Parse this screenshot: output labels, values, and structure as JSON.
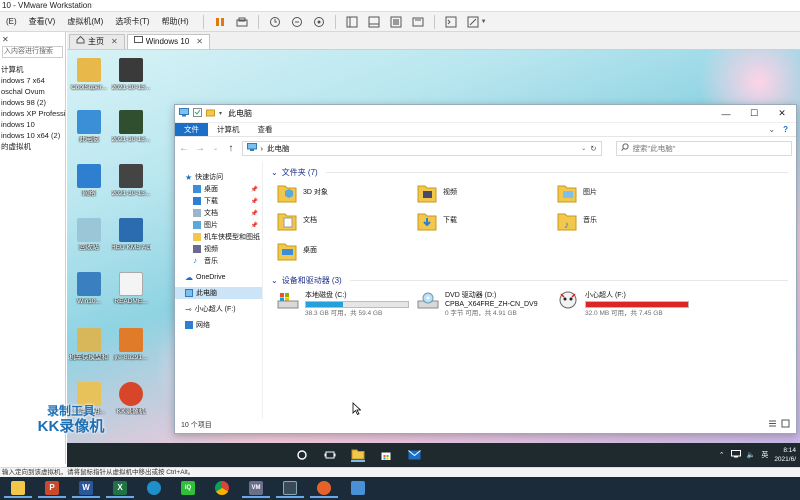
{
  "vmware": {
    "title": "10 - VMware Workstation",
    "menu": [
      "(E)",
      "查看(V)",
      "虚拟机(M)",
      "选项卡(T)",
      "帮助(H)"
    ],
    "library": {
      "search_placeholder": "入内容进行搜索",
      "items": [
        "计算机",
        "indows 7 x64",
        "oschal Ovum",
        "indows 98 (2)",
        "indows XP Professic",
        "indows 10",
        "indows 10 x64 (2)",
        "的虚拟机"
      ]
    },
    "tabs": [
      {
        "label": "主页",
        "icon": "home-icon"
      },
      {
        "label": "Windows 10",
        "icon": "vm-icon"
      }
    ],
    "status_text": "输入定向到该虚拟机，请将鼠标指针从虚拟机中移出或按 Ctrl+Alt。",
    "status_prefix": "到该"
  },
  "desktop": {
    "icons": [
      {
        "label": "CoolSuper...",
        "color": "#e8b84a"
      },
      {
        "label": "2021-10-13...",
        "color": "#3a3a3a"
      },
      {
        "label": "此电脑",
        "color": "#3b8fd6"
      },
      {
        "label": "2021-10-13...",
        "color": "#2f4f2f"
      },
      {
        "label": "网络",
        "color": "#2f7fd0"
      },
      {
        "label": "2021-10-13...",
        "color": "#444"
      },
      {
        "label": "回收站",
        "color": "#9ac6d8"
      },
      {
        "label": "HEU KMS Activato...",
        "color": "#2b6cb0"
      },
      {
        "label": "Win10...",
        "color": "#3a7fc0"
      },
      {
        "label": "README...",
        "color": "#f4f4f4"
      },
      {
        "label": "机车侠模型和...",
        "color": "#d8b65a"
      },
      {
        "label": "jre-8u291...",
        "color": "#e07b2a"
      },
      {
        "label": "使用说明...",
        "color": "#e7c15a"
      },
      {
        "label": "KK录像机",
        "color": "#d8462a"
      }
    ],
    "watermark": {
      "line1": "录制工具",
      "line2": "KK录像机"
    }
  },
  "explorer": {
    "title": "此电脑",
    "ribbon_tabs": [
      "文件",
      "计算机",
      "查看"
    ],
    "address": {
      "path": "此电脑"
    },
    "search_placeholder": "搜索\"此电脑\"",
    "nav": {
      "quick_access": "快速访问",
      "quick_items": [
        {
          "label": "桌面",
          "icon": "desktop-icon",
          "pinned": true
        },
        {
          "label": "下载",
          "icon": "download-icon",
          "pinned": true
        },
        {
          "label": "文档",
          "icon": "document-icon",
          "pinned": true
        },
        {
          "label": "图片",
          "icon": "picture-icon",
          "pinned": true
        },
        {
          "label": "机车侠模型和图纸",
          "icon": "folder-icon",
          "pinned": false
        },
        {
          "label": "视频",
          "icon": "video-icon",
          "pinned": false
        },
        {
          "label": "音乐",
          "icon": "music-icon",
          "pinned": false
        }
      ],
      "onedrive": "OneDrive",
      "this_pc": "此电脑",
      "usb": "小心超人 (F:)",
      "network": "网络"
    },
    "folders_header": "文件夹 (7)",
    "folders": [
      {
        "label": "3D 对象",
        "icon": "3d-objects-icon"
      },
      {
        "label": "视频",
        "icon": "video-folder-icon"
      },
      {
        "label": "图片",
        "icon": "picture-folder-icon"
      },
      {
        "label": "文档",
        "icon": "document-folder-icon"
      },
      {
        "label": "下载",
        "icon": "download-folder-icon"
      },
      {
        "label": "音乐",
        "icon": "music-folder-icon"
      },
      {
        "label": "桌面",
        "icon": "desktop-folder-icon"
      }
    ],
    "drives_header": "设备和驱动器 (3)",
    "drives": [
      {
        "name": "本地磁盘 (C:)",
        "free": "38.3 GB 可用，共 59.4 GB",
        "used_fraction": 0.36,
        "bar_color": "#26a0da",
        "icon": "hard-disk-icon"
      },
      {
        "name": "DVD 驱动器 (D:)",
        "name2": "CPBA_X64FRE_ZH-CN_DV9",
        "free": "0 字节 可用，共 4.91 GB",
        "used_fraction": 1.0,
        "bar_color": "#26a0da",
        "icon": "dvd-drive-icon"
      },
      {
        "name": "小心超人 (F:)",
        "free": "32.0 MB 可用，共 7.45 GB",
        "used_fraction": 0.996,
        "bar_color": "#da2626",
        "icon": "usb-drive-icon"
      }
    ],
    "status": "10 个项目"
  },
  "guest_taskbar": {
    "lang": "英",
    "time": "8:14",
    "date": "2021/6/"
  }
}
